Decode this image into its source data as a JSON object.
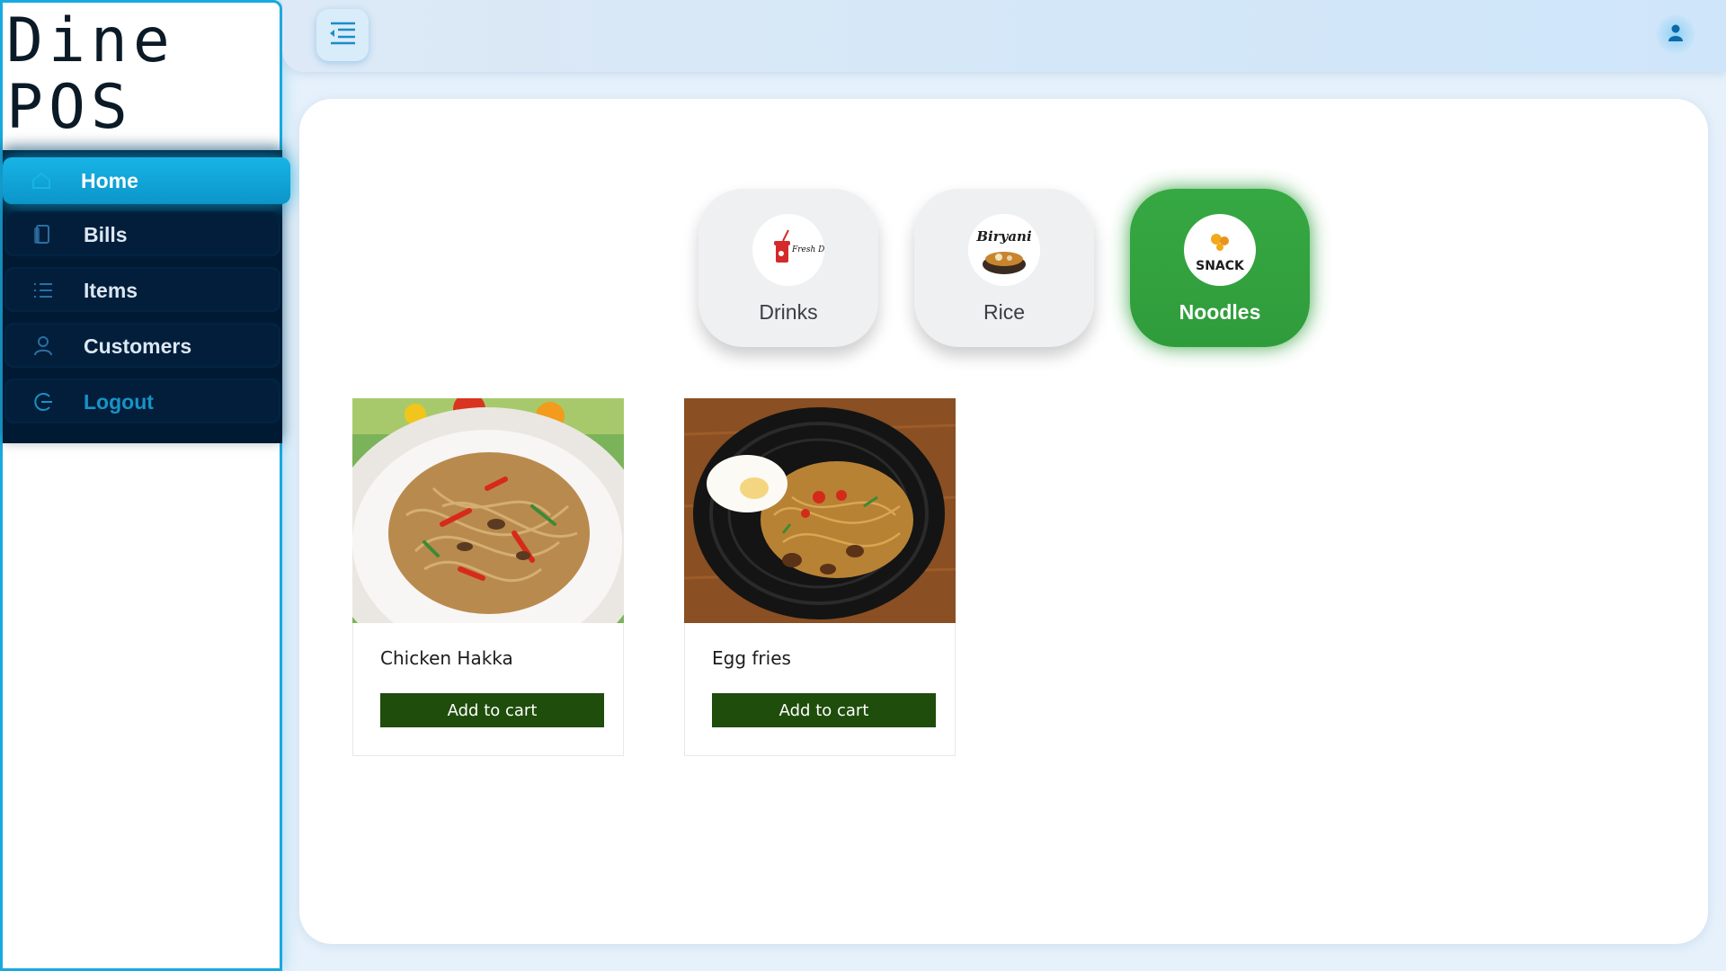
{
  "brand": {
    "line1": "Dine",
    "line2": "POS"
  },
  "sidebar": {
    "items": [
      {
        "label": "Home",
        "icon": "home-icon",
        "active": true
      },
      {
        "label": "Bills",
        "icon": "bill-icon"
      },
      {
        "label": "Items",
        "icon": "list-icon"
      },
      {
        "label": "Customers",
        "icon": "user-icon"
      },
      {
        "label": "Logout",
        "icon": "logout-icon"
      }
    ]
  },
  "header": {
    "menu_icon": "menu-collapse-icon",
    "user_icon": "user-avatar-icon",
    "accent": "#1aa9df"
  },
  "categories": [
    {
      "label": "Drinks",
      "logo_text": "Fresh Drink",
      "active": false
    },
    {
      "label": "Rice",
      "logo_text": "Biryani",
      "active": false
    },
    {
      "label": "Noodles",
      "logo_text": "SNACK",
      "active": true,
      "color": "#33a53f"
    }
  ],
  "products": [
    {
      "name": "Chicken Hakka",
      "button": "Add to cart"
    },
    {
      "name": "Egg fries",
      "button": "Add to cart"
    }
  ],
  "colors": {
    "button": "#1f4d0c",
    "nav_bg": "#011a33",
    "active_nav": "#18b4e6"
  }
}
